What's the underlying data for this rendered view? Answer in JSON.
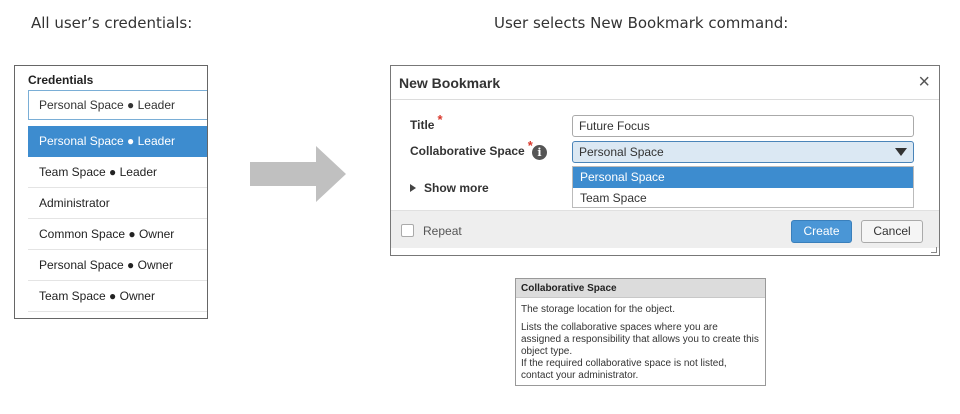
{
  "captions": {
    "left": "All user’s credentials:",
    "right": "User selects New Bookmark command:"
  },
  "credentials": {
    "title": "Credentials",
    "current_value": "Personal Space ● Leader",
    "items": [
      {
        "label": "Personal Space ● Leader",
        "selected": true
      },
      {
        "label": "Team Space ● Leader",
        "selected": false
      },
      {
        "label": "Administrator",
        "selected": false
      },
      {
        "label": "Common Space ● Owner",
        "selected": false
      },
      {
        "label": "Personal Space ● Owner",
        "selected": false
      },
      {
        "label": "Team Space ● Owner",
        "selected": false
      }
    ]
  },
  "arrow": {
    "icon": "right-arrow-icon",
    "color": "#c0c0c0"
  },
  "dialog": {
    "title": "New Bookmark",
    "close_icon": "×",
    "fields": {
      "title_label": "Title",
      "title_value": "Future Focus",
      "space_label": "Collaborative Space",
      "space_value": "Personal Space",
      "required_mark": "*",
      "info_icon": "i"
    },
    "dropdown_options": [
      {
        "label": "Personal Space",
        "selected": true
      },
      {
        "label": "Team Space",
        "selected": false
      }
    ],
    "show_more": "Show more",
    "footer": {
      "repeat_label": "Repeat",
      "create_label": "Create",
      "cancel_label": "Cancel"
    }
  },
  "tooltip": {
    "title": "Collaborative Space",
    "p1": "The storage location for the object.",
    "p2": "Lists the collaborative spaces where you are assigned a responsibility that allows you to create this object type.",
    "p3": "If the required collaborative space is not listed, contact your administrator."
  },
  "colors": {
    "accent": "#3d8ccf",
    "required": "#d9372b",
    "create_button": "#4a96d6"
  }
}
